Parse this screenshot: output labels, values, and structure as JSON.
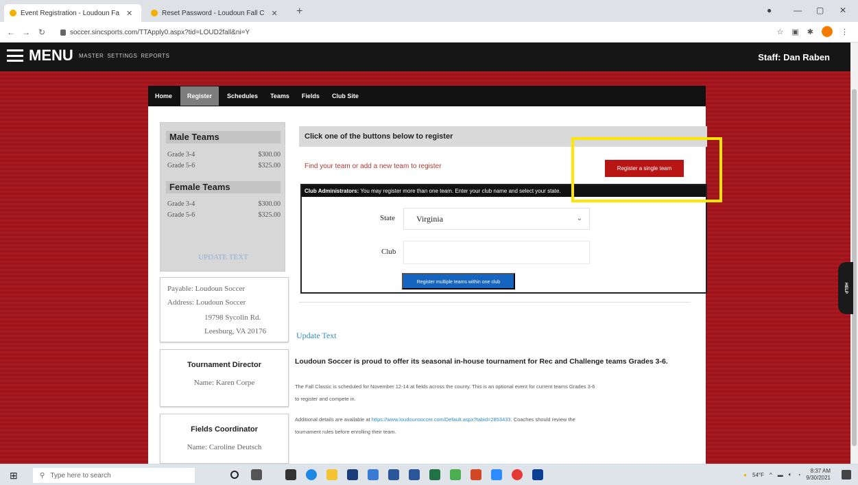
{
  "browser": {
    "tabs": [
      {
        "title": "Event Registration - Loudoun Fa"
      },
      {
        "title": "Reset Password - Loudoun Fall C"
      }
    ],
    "new_tab": "+",
    "url": "soccer.sincsports.com/TTApply0.aspx?tid=LOUD2fall&ni=Y"
  },
  "header": {
    "menu_label": "MENU",
    "links": [
      "MASTER",
      "SETTINGS",
      "REPORTS"
    ],
    "staff": "Staff: Dan Raben"
  },
  "nav": {
    "items": [
      "Home",
      "Register",
      "Schedules",
      "Teams",
      "Fields",
      "Club Site"
    ],
    "active": "Register"
  },
  "pricing": {
    "male_title": "Male Teams",
    "male": [
      {
        "grade": "Grade 3-4",
        "price": "$300.00"
      },
      {
        "grade": "Grade 5-6",
        "price": "$325.00"
      }
    ],
    "female_title": "Female Teams",
    "female": [
      {
        "grade": "Grade 3-4",
        "price": "$300.00"
      },
      {
        "grade": "Grade 5-6",
        "price": "$325.00"
      }
    ],
    "update_text": "UPDATE TEXT"
  },
  "payable": {
    "payable": "Payable: Loudoun Soccer",
    "address1": "Address: Loudoun Soccer",
    "address2": "19798 Sycolin Rd.",
    "address3": "Leesburg, VA 20176"
  },
  "director": {
    "title": "Tournament Director",
    "name": "Name: Karen Corpe"
  },
  "fields_coord": {
    "title": "Fields Coordinator",
    "name": "Name: Caroline Deutsch"
  },
  "register": {
    "heading": "Click one of the buttons below to register",
    "find_text": "Find your team or add a new team to register",
    "single_button": "Register a single team",
    "club_admin_label": "Club Administrators:",
    "club_admin_text": " You may register more than one team. Enter your club name and select your state.",
    "state_label": "State",
    "state_value": "Virginia",
    "club_label": "Club",
    "club_value": "",
    "multi_button": "Register multiple teams within one club"
  },
  "body": {
    "update_link": "Update Text",
    "promo": "Loudoun Soccer is proud to offer its seasonal in-house tournament for Rec and Challenge teams Grades 3-6.",
    "para1_line1": "The Fall Classic is scheduled for November 12-14 at fields across the county. This is an optional event for current teams Grades 3-6",
    "para1_line2": "to register and compete in.",
    "para2_pre": "Additional details are available at ",
    "para2_link": "https://www.loudounsoccer.com/Default.aspx?tabid=2853433",
    "para2_post": ". Coaches should review the",
    "para2_line2": "tournament rules before enrolling their team."
  },
  "help_tab": "HELP",
  "taskbar": {
    "search_placeholder": "Type here to search",
    "weather": "54°F",
    "time": "8:37 AM",
    "date": "9/30/2021"
  }
}
